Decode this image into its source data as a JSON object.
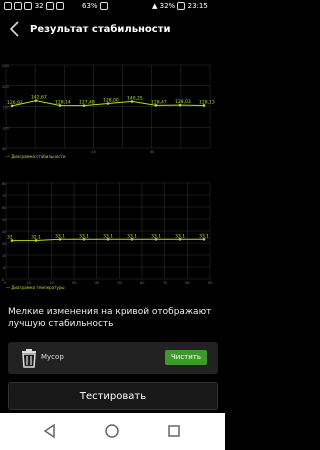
{
  "status": {
    "battery_small": "63%",
    "battery_main": "32%",
    "time": "23:15",
    "notif_count": "32"
  },
  "header": {
    "title": "Результат стабильности"
  },
  "icons": {
    "back": "chevron-left-icon",
    "trash": "trash-icon",
    "nav_back": "triangle-back-icon",
    "nav_home": "circle-home-icon",
    "nav_recent": "square-recent-icon"
  },
  "colors": {
    "series": "#b7e021",
    "grid": "#333333",
    "button": "#3d9a2a"
  },
  "chart_data": [
    {
      "type": "line",
      "title": "",
      "legend": "Диаграмма стабильности",
      "x_ticks": [
        "",
        "",
        "",
        "20",
        "",
        "40",
        "",
        ""
      ],
      "y_ticks": [
        "250",
        "200",
        "150",
        "100",
        "50"
      ],
      "ylim": [
        0,
        250
      ],
      "points": [
        {
          "x": 0,
          "y": 126.92,
          "label": "126,92"
        },
        {
          "x": 1,
          "y": 142.67,
          "label": "142,67"
        },
        {
          "x": 2,
          "y": 128.14,
          "label": "128,14"
        },
        {
          "x": 3,
          "y": 127.48,
          "label": "127,48"
        },
        {
          "x": 4,
          "y": 134.0,
          "label": "128,00"
        },
        {
          "x": 5,
          "y": 140.25,
          "label": "140,25"
        },
        {
          "x": 6,
          "y": 128.47,
          "label": "128,47"
        },
        {
          "x": 7,
          "y": 129.03,
          "label": "128,03"
        },
        {
          "x": 8,
          "y": 128.13,
          "label": "128,13"
        }
      ]
    },
    {
      "type": "line",
      "title": "",
      "legend": "Диаграмма температуры",
      "x_ticks": [
        "0",
        "10",
        "20",
        "30",
        "40",
        "50",
        "60",
        "70",
        "80",
        "90"
      ],
      "y_ticks": [
        "80",
        "70",
        "60",
        "50",
        "40",
        "30",
        "20",
        "10",
        "0"
      ],
      "ylim": [
        0,
        80
      ],
      "points": [
        {
          "x": 0,
          "y": 32,
          "label": "32"
        },
        {
          "x": 1,
          "y": 32.1,
          "label": "32,1"
        },
        {
          "x": 2,
          "y": 33.1,
          "label": "33,1"
        },
        {
          "x": 3,
          "y": 33.1,
          "label": "33,1"
        },
        {
          "x": 4,
          "y": 33.1,
          "label": "33,1"
        },
        {
          "x": 5,
          "y": 33.1,
          "label": "33,1"
        },
        {
          "x": 6,
          "y": 33.1,
          "label": "33,1"
        },
        {
          "x": 7,
          "y": 33.1,
          "label": "33,1"
        },
        {
          "x": 8,
          "y": 33.1,
          "label": "33,1"
        }
      ]
    }
  ],
  "note": "Мелкие изменения на кривой отображают лучшую стабильность",
  "trash": {
    "label": "Мусор",
    "button": "Чистить"
  },
  "test_button": "Тестировать"
}
